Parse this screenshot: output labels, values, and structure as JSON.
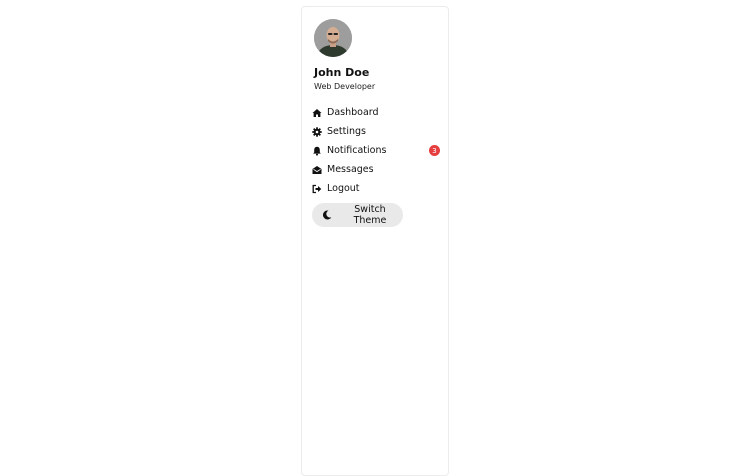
{
  "user": {
    "name": "John Doe",
    "role": "Web Developer"
  },
  "nav": {
    "items": [
      {
        "label": "Dashboard",
        "icon": "home-icon"
      },
      {
        "label": "Settings",
        "icon": "gear-icon"
      },
      {
        "label": "Notifications",
        "icon": "bell-icon",
        "badge": "3"
      },
      {
        "label": "Messages",
        "icon": "envelope-open-icon"
      },
      {
        "label": "Logout",
        "icon": "sign-out-icon"
      }
    ]
  },
  "theme_button": {
    "label": "Switch Theme",
    "icon": "moon-icon"
  },
  "colors": {
    "badge": "#e53e3e",
    "button_bg": "#e9e9e9",
    "border": "#ececec"
  }
}
